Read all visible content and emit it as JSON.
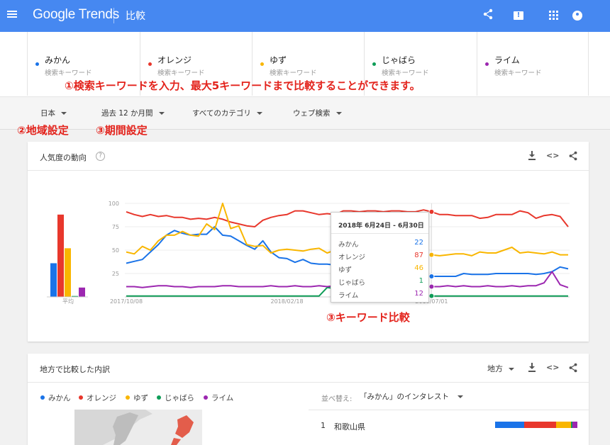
{
  "header": {
    "logo_text": "Google Trends",
    "page_title": "比較",
    "brand_color": "#4688f1",
    "icons": [
      "menu-icon",
      "share-icon",
      "feedback-icon",
      "apps-icon",
      "account-icon"
    ]
  },
  "keywords": [
    {
      "name": "みかん",
      "sub": "検索キーワード",
      "color": "#1a73e8"
    },
    {
      "name": "オレンジ",
      "sub": "検索キーワード",
      "color": "#e8372c"
    },
    {
      "name": "ゆず",
      "sub": "検索キーワード",
      "color": "#f9b600"
    },
    {
      "name": "じゃばら",
      "sub": "検索キーワード",
      "color": "#0f9d58"
    },
    {
      "name": "ライム",
      "sub": "検索キーワード",
      "color": "#9c27b0"
    }
  ],
  "annotations": {
    "keywords_note": "①検索キーワードを入力、最大5キーワードまで比較することができます。",
    "region_note": "②地域設定",
    "period_note": "③期間設定",
    "compare_note": "③キーワード比較"
  },
  "filters": {
    "region": "日本",
    "period": "過去 12 か月間",
    "category": "すべてのカテゴリ",
    "search_type": "ウェブ検索"
  },
  "interest_card": {
    "title": "人気度の動向",
    "avg_label": "平均"
  },
  "tooltip": {
    "title": "2018年 6月24日 - 6月30日",
    "rows": [
      {
        "name": "みかん",
        "value": "22"
      },
      {
        "name": "オレンジ",
        "value": "87"
      },
      {
        "name": "ゆず",
        "value": "46"
      },
      {
        "name": "じゃばら",
        "value": "1"
      },
      {
        "name": "ライム",
        "value": "12"
      }
    ]
  },
  "chart_data": {
    "type": "line",
    "ylim": [
      0,
      100
    ],
    "yticks": [
      "100",
      "75",
      "50",
      "25"
    ],
    "xtick_labels": [
      "2017/10/08",
      "2018/02/18",
      "2018/07/01"
    ],
    "averages": [
      {
        "name": "みかん",
        "value": 36
      },
      {
        "name": "オレンジ",
        "value": 88
      },
      {
        "name": "ゆず",
        "value": 52
      },
      {
        "name": "じゃばら",
        "value": 1
      },
      {
        "name": "ライム",
        "value": 10
      }
    ],
    "series": [
      {
        "name": "みかん",
        "color": "#1a73e8",
        "values": [
          36,
          38,
          40,
          48,
          56,
          66,
          71,
          68,
          66,
          67,
          67,
          75,
          66,
          65,
          60,
          55,
          51,
          60,
          48,
          42,
          41,
          37,
          40,
          36,
          35,
          35,
          34,
          34,
          31,
          29,
          28,
          27,
          25,
          24,
          23,
          24,
          23,
          22,
          22,
          22,
          22,
          22,
          25,
          24,
          24,
          24,
          25,
          25,
          25,
          25,
          25,
          24,
          25,
          27,
          32,
          30
        ]
      },
      {
        "name": "オレンジ",
        "color": "#e8372c",
        "values": [
          91,
          88,
          86,
          88,
          86,
          87,
          85,
          85,
          83,
          84,
          83,
          85,
          83,
          80,
          78,
          76,
          75,
          82,
          85,
          87,
          88,
          92,
          92,
          90,
          88,
          89,
          88,
          92,
          92,
          91,
          92,
          92,
          91,
          92,
          92,
          91,
          91,
          93,
          91,
          88,
          88,
          87,
          87,
          87,
          84,
          85,
          88,
          88,
          88,
          92,
          90,
          84,
          87,
          88,
          86,
          75
        ]
      },
      {
        "name": "ゆず",
        "color": "#f9b600",
        "values": [
          48,
          46,
          54,
          50,
          60,
          66,
          66,
          70,
          66,
          65,
          78,
          72,
          100,
          73,
          76,
          56,
          54,
          55,
          47,
          50,
          51,
          50,
          49,
          51,
          52,
          47,
          50,
          49,
          47,
          47,
          46,
          47,
          48,
          47,
          50,
          52,
          50,
          48,
          45,
          44,
          45,
          46,
          46,
          44,
          48,
          47,
          47,
          50,
          53,
          47,
          48,
          47,
          46,
          48,
          45,
          45
        ]
      },
      {
        "name": "じゃばら",
        "color": "#0f9d58",
        "values": [
          1,
          1,
          1,
          1,
          1,
          1,
          1,
          1,
          1,
          1,
          1,
          1,
          1,
          1,
          1,
          1,
          1,
          1,
          1,
          1,
          1,
          1,
          1,
          1,
          1,
          10,
          9,
          8,
          5,
          4,
          3,
          2,
          1,
          1,
          1,
          1,
          1,
          1,
          1,
          1,
          1,
          1,
          1,
          1,
          1,
          1,
          1,
          1,
          1,
          1,
          1,
          1,
          1,
          1,
          1,
          1
        ]
      },
      {
        "name": "ライム",
        "color": "#9c27b0",
        "values": [
          11,
          11,
          10,
          11,
          12,
          12,
          11,
          11,
          10,
          11,
          11,
          11,
          12,
          12,
          11,
          11,
          11,
          11,
          12,
          11,
          11,
          12,
          11,
          11,
          12,
          11,
          12,
          12,
          11,
          11,
          12,
          11,
          12,
          11,
          11,
          12,
          11,
          12,
          11,
          11,
          12,
          11,
          12,
          11,
          11,
          12,
          11,
          11,
          12,
          11,
          12,
          12,
          15,
          27,
          13,
          10
        ]
      }
    ]
  },
  "region_card": {
    "title": "地方で比較した内訳",
    "resolution": "地方",
    "sort_label": "並べ替え:",
    "sort_value": "「みかん」のインタレスト",
    "ranks": [
      {
        "rank": "1",
        "name": "和歌山県",
        "shares": [
          35,
          39,
          18,
          2,
          6
        ]
      }
    ]
  }
}
